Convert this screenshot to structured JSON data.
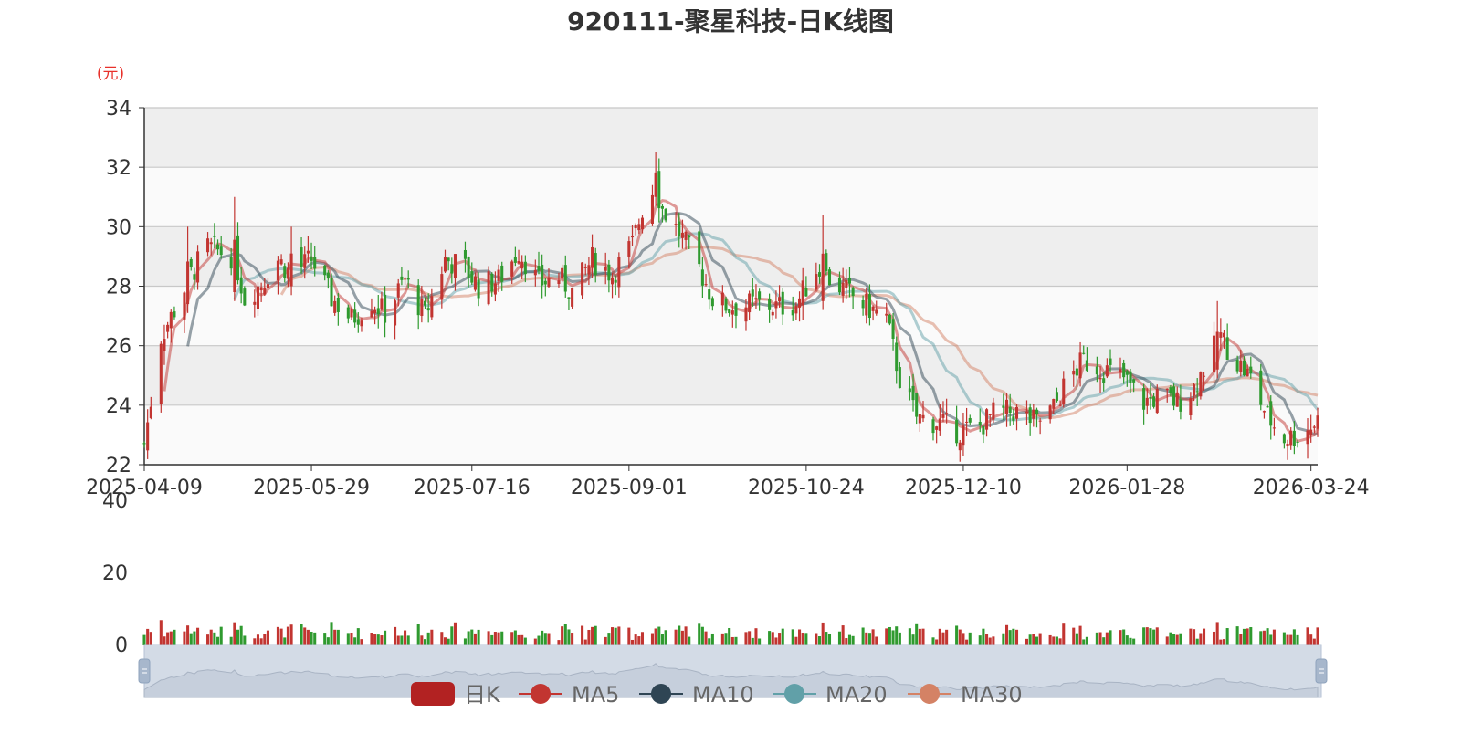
{
  "chart_data": [
    {
      "type": "candlestick",
      "title": "920111-聚星科技-日K线图",
      "ylabel": "(元)",
      "ylim": [
        22,
        34
      ],
      "yticks": [
        22,
        24,
        26,
        28,
        30,
        32,
        34
      ],
      "xticks": [
        "2025-04-09",
        "2025-05-29",
        "2025-07-16",
        "2025-09-01",
        "2025-10-24",
        "2025-12-10",
        "2026-01-28",
        "2026-03-24"
      ],
      "date_range": [
        "2025-04-09",
        "2026-03-26"
      ],
      "grid": true,
      "up_color": "#c23531",
      "down_color": "#2f9a2f",
      "close_path": [
        [
          "2025-04-09",
          22.7
        ],
        [
          "2025-04-14",
          26.3
        ],
        [
          "2025-04-18",
          27.2
        ],
        [
          "2025-04-23",
          28.4
        ],
        [
          "2025-04-28",
          29.3
        ],
        [
          "2025-05-06",
          29.0
        ],
        [
          "2025-05-09",
          27.6
        ],
        [
          "2025-05-14",
          28.1
        ],
        [
          "2025-05-19",
          28.9
        ],
        [
          "2025-05-23",
          28.4
        ],
        [
          "2025-05-29",
          28.9
        ],
        [
          "2025-06-04",
          27.6
        ],
        [
          "2025-06-10",
          26.9
        ],
        [
          "2025-06-16",
          27.5
        ],
        [
          "2025-06-20",
          27.1
        ],
        [
          "2025-06-26",
          28.2
        ],
        [
          "2025-07-02",
          27.0
        ],
        [
          "2025-07-08",
          28.9
        ],
        [
          "2025-07-14",
          28.6
        ],
        [
          "2025-07-18",
          28.0
        ],
        [
          "2025-07-24",
          28.2
        ],
        [
          "2025-07-30",
          29.2
        ],
        [
          "2025-08-05",
          28.1
        ],
        [
          "2025-08-11",
          28.3
        ],
        [
          "2025-08-15",
          27.8
        ],
        [
          "2025-08-21",
          28.9
        ],
        [
          "2025-08-27",
          28.4
        ],
        [
          "2025-09-02",
          29.4
        ],
        [
          "2025-09-05",
          30.6
        ],
        [
          "2025-09-09",
          31.4
        ],
        [
          "2025-09-11",
          30.6
        ],
        [
          "2025-09-16",
          29.8
        ],
        [
          "2025-09-22",
          28.6
        ],
        [
          "2025-09-26",
          27.6
        ],
        [
          "2025-10-01",
          27.3
        ],
        [
          "2025-10-09",
          27.4
        ],
        [
          "2025-10-15",
          27.3
        ],
        [
          "2025-10-21",
          27.4
        ],
        [
          "2025-10-27",
          28.6
        ],
        [
          "2025-11-03",
          28.0
        ],
        [
          "2025-11-10",
          27.4
        ],
        [
          "2025-11-17",
          26.9
        ],
        [
          "2025-11-21",
          24.9
        ],
        [
          "2025-11-26",
          23.6
        ],
        [
          "2025-12-03",
          23.4
        ],
        [
          "2025-12-09",
          23.1
        ],
        [
          "2025-12-15",
          23.3
        ],
        [
          "2025-12-19",
          23.7
        ],
        [
          "2025-12-25",
          23.8
        ],
        [
          "2026-01-01",
          23.4
        ],
        [
          "2026-01-06",
          23.9
        ],
        [
          "2026-01-10",
          24.8
        ],
        [
          "2026-01-15",
          25.5
        ],
        [
          "2026-01-21",
          25.2
        ],
        [
          "2026-01-27",
          24.9
        ],
        [
          "2026-02-02",
          24.1
        ],
        [
          "2026-02-07",
          24.3
        ],
        [
          "2026-02-12",
          24.1
        ],
        [
          "2026-02-17",
          24.6
        ],
        [
          "2026-02-21",
          25.5
        ],
        [
          "2026-02-25",
          26.3
        ],
        [
          "2026-03-01",
          25.6
        ],
        [
          "2026-03-06",
          24.9
        ],
        [
          "2026-03-11",
          23.6
        ],
        [
          "2026-03-16",
          22.9
        ],
        [
          "2026-03-21",
          23.0
        ],
        [
          "2026-03-26",
          23.5
        ]
      ],
      "spikes": [
        [
          "2025-04-22",
          27.4,
          30.0
        ],
        [
          "2025-05-06",
          27.8,
          31.0
        ],
        [
          "2025-05-23",
          28.0,
          30.0
        ],
        [
          "2025-09-09",
          31.0,
          32.5
        ],
        [
          "2025-10-29",
          27.5,
          30.4
        ],
        [
          "2026-02-24",
          25.2,
          27.5
        ]
      ],
      "series": [
        {
          "name": "日K",
          "color": "#b22222"
        },
        {
          "name": "MA5",
          "color": "#c23531"
        },
        {
          "name": "MA10",
          "color": "#2f4554"
        },
        {
          "name": "MA20",
          "color": "#61a0a8"
        },
        {
          "name": "MA30",
          "color": "#d48265"
        }
      ]
    },
    {
      "type": "bar",
      "yticks": [
        0,
        20,
        40
      ],
      "ylim": [
        0,
        40
      ]
    }
  ],
  "legend_items": [
    "日K",
    "MA5",
    "MA10",
    "MA20",
    "MA30"
  ]
}
